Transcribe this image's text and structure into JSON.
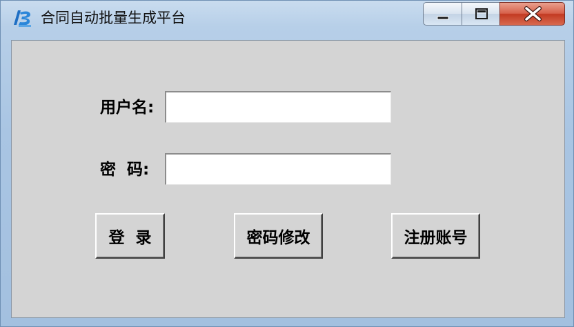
{
  "window": {
    "title": "合同自动批量生成平台",
    "icon": "app-logo-icon",
    "controls": {
      "minimize": "minimize-icon",
      "maximize": "maximize-icon",
      "close": "close-icon"
    }
  },
  "form": {
    "username_label": "用户名:",
    "username_value": "",
    "password_label": "密  码:",
    "password_value": ""
  },
  "buttons": {
    "login": "登  录",
    "change_password": "密码修改",
    "register": "注册账号"
  },
  "colors": {
    "client_bg": "#d4d4d4",
    "close_button": "#c23a22",
    "titlebar": "#b7cfe8"
  }
}
